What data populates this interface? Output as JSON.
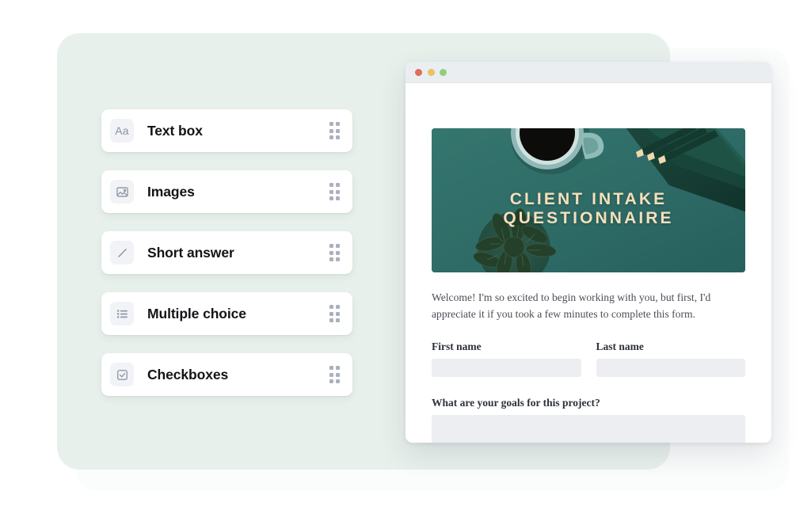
{
  "palette": {
    "mint_panel": "#e8f0ec",
    "page_background": "#ffffff",
    "card_white": "#ffffff",
    "icon_tile": "#f2f3f6",
    "icon_stroke": "#8b93a5",
    "drag_dot": "#aab0bd",
    "hero_teal": "#2e6a67",
    "hero_title_cream": "#f4e0bb",
    "input_fill": "#eceef1",
    "titlebar": "#ebeef0",
    "traffic_red": "#e06c5a",
    "traffic_yellow": "#e8c35e",
    "traffic_green": "#8cd07a"
  },
  "block_library": {
    "items": [
      {
        "label": "Text box",
        "icon": "text-format-icon",
        "handle": "drag-handle-icon"
      },
      {
        "label": "Images",
        "icon": "image-icon",
        "handle": "drag-handle-icon"
      },
      {
        "label": "Short answer",
        "icon": "pencil-icon",
        "handle": "drag-handle-icon"
      },
      {
        "label": "Multiple choice",
        "icon": "bulleted-list-icon",
        "handle": "drag-handle-icon"
      },
      {
        "label": "Checkboxes",
        "icon": "checkbox-checked-icon",
        "handle": "drag-handle-icon"
      }
    ]
  },
  "browser": {
    "traffic_lights": [
      "close-dot",
      "minimize-dot",
      "maximize-dot"
    ]
  },
  "form": {
    "hero": {
      "title_line_1": "CLIENT INTAKE",
      "title_line_2": "QUESTIONNAIRE",
      "scene": "flat-lay of coffee cup, notebook with pencils and a plant on a teal desk"
    },
    "welcome_text": "Welcome! I'm so excited to begin working with you, but first, I'd appreciate it if you took a few minutes to complete this form.",
    "fields": [
      {
        "label": "First name",
        "value": "",
        "type": "text"
      },
      {
        "label": "Last name",
        "value": "",
        "type": "text"
      }
    ],
    "goals_question": {
      "label": "What are your goals for this project?",
      "value": "",
      "type": "textarea"
    }
  }
}
